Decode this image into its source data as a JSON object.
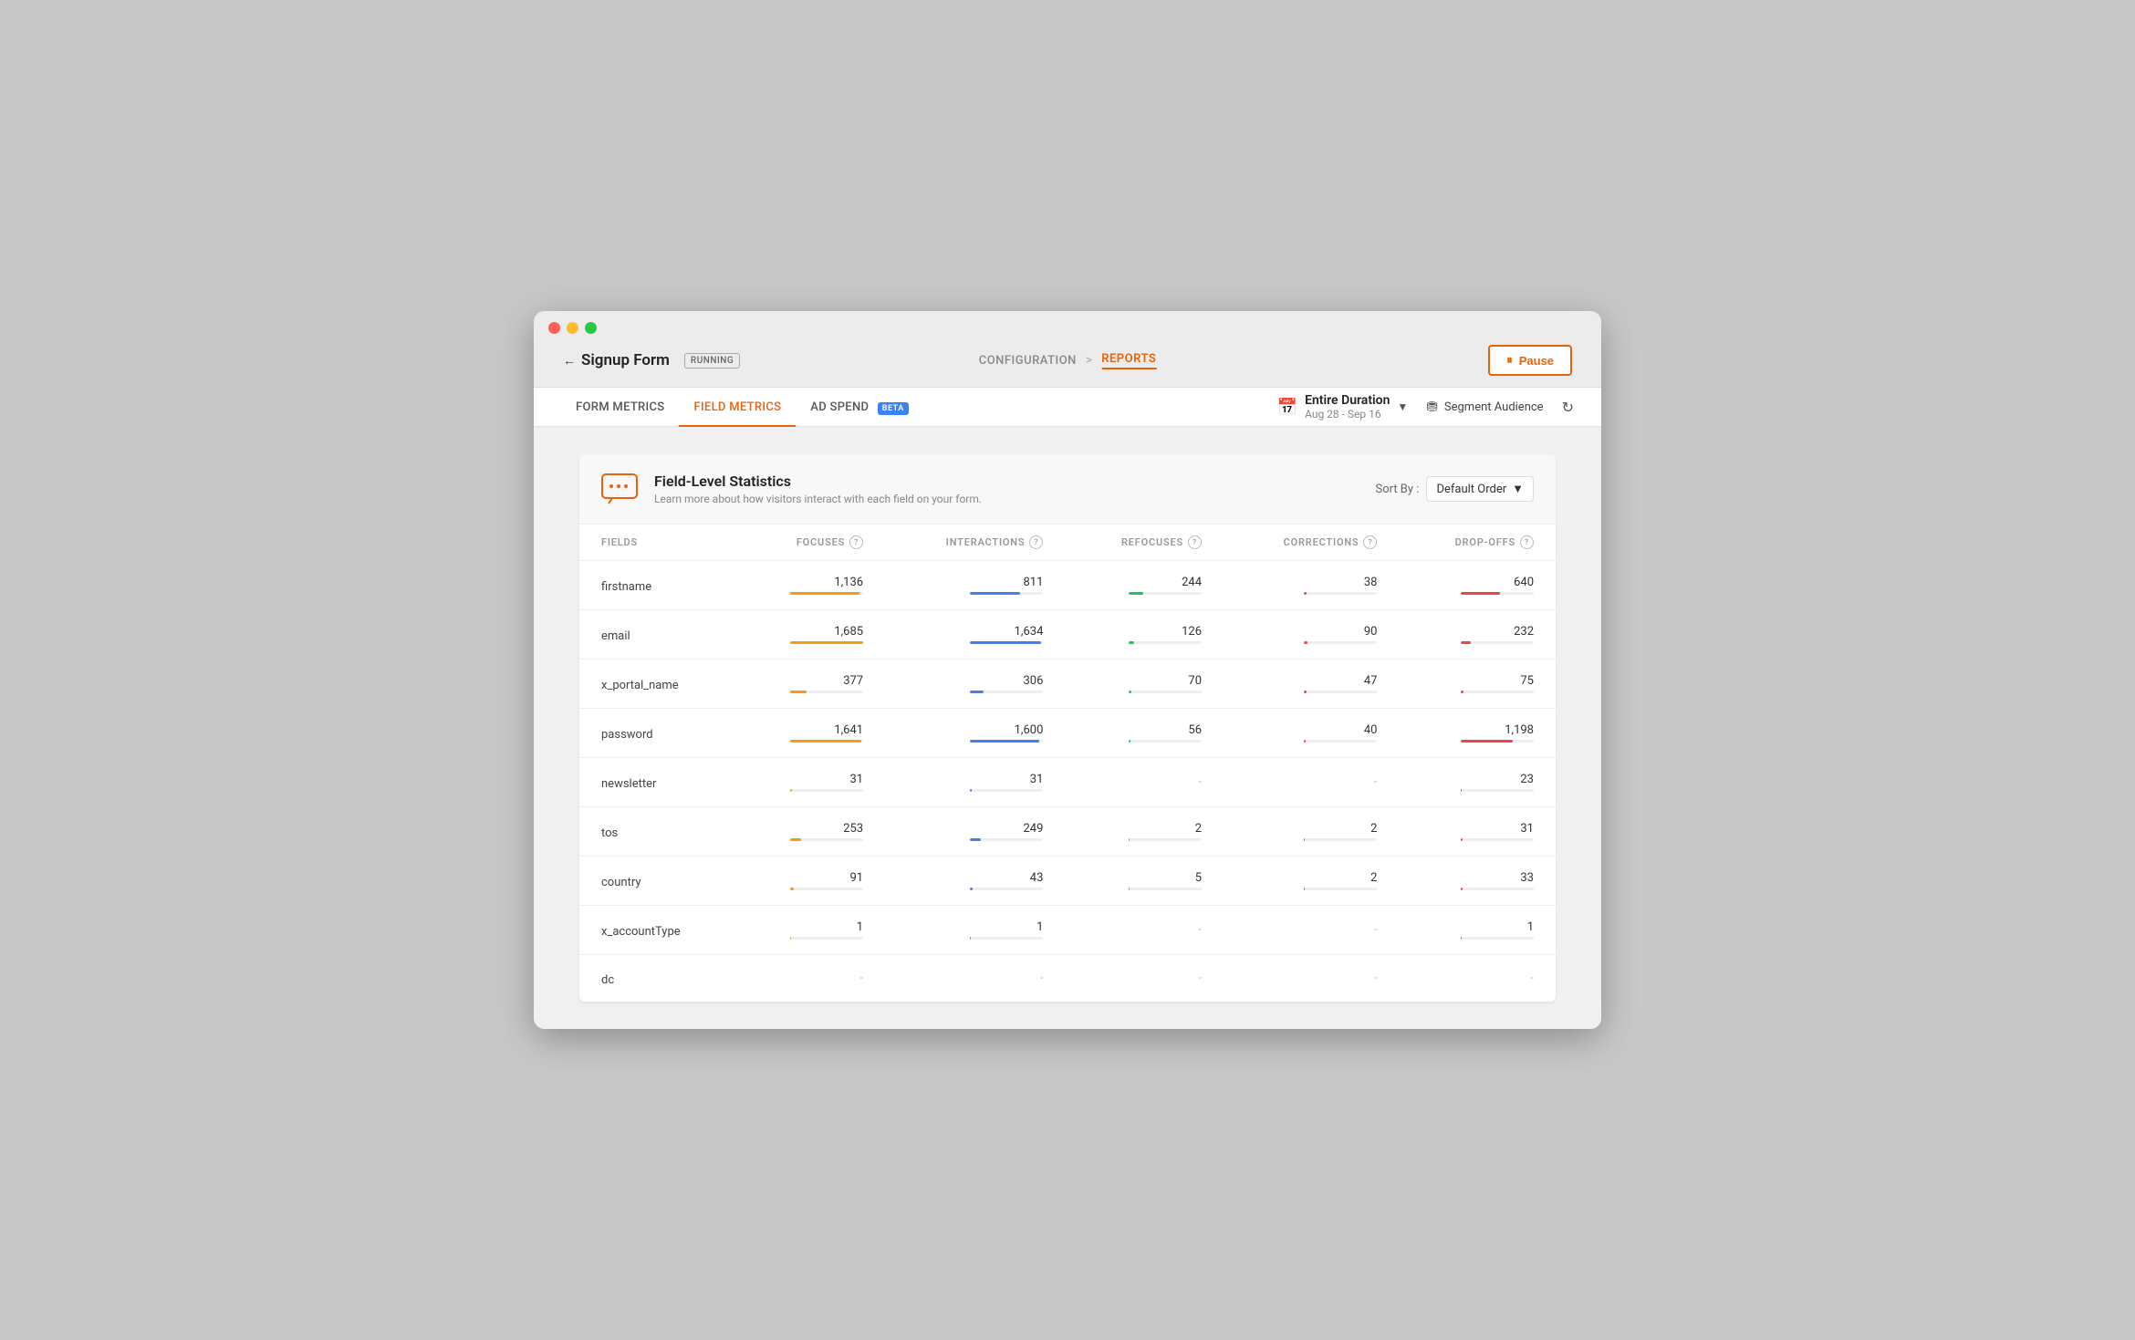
{
  "window": {
    "title": "Signup Form",
    "status": "RUNNING"
  },
  "nav": {
    "back_label": "Signup Form",
    "breadcrumb_config": "CONFIGURATION",
    "breadcrumb_sep": ">",
    "breadcrumb_reports": "REPORTS"
  },
  "pause_button": "Pause",
  "tabs": [
    {
      "id": "form-metrics",
      "label": "FORM METRICS",
      "active": false
    },
    {
      "id": "field-metrics",
      "label": "FIELD METRICS",
      "active": true
    },
    {
      "id": "ad-spend",
      "label": "AD SPEND",
      "active": false,
      "beta": true
    }
  ],
  "toolbar": {
    "date_label": "Entire Duration",
    "date_range": "Aug 28 - Sep 16",
    "segment_label": "Segment Audience"
  },
  "stats": {
    "title": "Field-Level Statistics",
    "subtitle": "Learn more about how visitors interact with each field on your form.",
    "sort_label": "Sort By :",
    "sort_value": "Default Order"
  },
  "table": {
    "headers": [
      {
        "id": "fields",
        "label": "FIELDS"
      },
      {
        "id": "focuses",
        "label": "FOCUSES"
      },
      {
        "id": "interactions",
        "label": "INTERACTIONS"
      },
      {
        "id": "refocuses",
        "label": "REFOCUSES"
      },
      {
        "id": "corrections",
        "label": "CORRECTIONS"
      },
      {
        "id": "dropoffs",
        "label": "DROP-OFFS"
      }
    ],
    "rows": [
      {
        "field": "firstname",
        "focuses": "1,136",
        "focuses_pct": 95,
        "interactions": "811",
        "interactions_pct": 68,
        "interactions_color": "#3b82f6",
        "refocuses": "244",
        "refocuses_pct": 20,
        "refocuses_color": "#22c55e",
        "corrections": "38",
        "corrections_pct": 3,
        "corrections_color": "#ef4444",
        "dropoffs": "640",
        "dropoffs_pct": 54,
        "dropoffs_color": "#ef4444"
      },
      {
        "field": "email",
        "focuses": "1,685",
        "focuses_pct": 100,
        "interactions": "1,634",
        "interactions_pct": 97,
        "interactions_color": "#3b82f6",
        "refocuses": "126",
        "refocuses_pct": 7,
        "refocuses_color": "#22c55e",
        "corrections": "90",
        "corrections_pct": 5,
        "corrections_color": "#ef4444",
        "dropoffs": "232",
        "dropoffs_pct": 14,
        "dropoffs_color": "#ef4444"
      },
      {
        "field": "x_portal_name",
        "focuses": "377",
        "focuses_pct": 22,
        "interactions": "306",
        "interactions_pct": 18,
        "interactions_color": "#3b82f6",
        "refocuses": "70",
        "refocuses_pct": 4,
        "refocuses_color": "#22c55e",
        "corrections": "47",
        "corrections_pct": 3,
        "corrections_color": "#ef4444",
        "dropoffs": "75",
        "dropoffs_pct": 4,
        "dropoffs_color": "#ef4444"
      },
      {
        "field": "password",
        "focuses": "1,641",
        "focuses_pct": 97,
        "interactions": "1,600",
        "interactions_pct": 95,
        "interactions_color": "#3b82f6",
        "refocuses": "56",
        "refocuses_pct": 3,
        "refocuses_color": "#22c55e",
        "corrections": "40",
        "corrections_pct": 2,
        "corrections_color": "#ef4444",
        "dropoffs": "1,198",
        "dropoffs_pct": 71,
        "dropoffs_color": "#ef4444"
      },
      {
        "field": "newsletter",
        "focuses": "31",
        "focuses_pct": 2,
        "interactions": "31",
        "interactions_pct": 2,
        "interactions_color": "#3b82f6",
        "refocuses": null,
        "corrections": null,
        "dropoffs": "23",
        "dropoffs_pct": 1,
        "dropoffs_color": "#ef4444"
      },
      {
        "field": "tos",
        "focuses": "253",
        "focuses_pct": 15,
        "interactions": "249",
        "interactions_pct": 15,
        "interactions_color": "#3b82f6",
        "refocuses": "2",
        "refocuses_pct": 0.1,
        "refocuses_color": "#22c55e",
        "corrections": "2",
        "corrections_pct": 0.1,
        "corrections_color": "#ef4444",
        "dropoffs": "31",
        "dropoffs_pct": 2,
        "dropoffs_color": "#ef4444"
      },
      {
        "field": "country",
        "focuses": "91",
        "focuses_pct": 5,
        "interactions": "43",
        "interactions_pct": 3,
        "interactions_color": "#3b82f6",
        "refocuses": "5",
        "refocuses_pct": 0.3,
        "refocuses_color": "#22c55e",
        "corrections": "2",
        "corrections_pct": 0.1,
        "corrections_color": "#ef4444",
        "dropoffs": "33",
        "dropoffs_pct": 2,
        "dropoffs_color": "#ef4444"
      },
      {
        "field": "x_accountType",
        "focuses": "1",
        "focuses_pct": 0.1,
        "interactions": "1",
        "interactions_pct": 0.1,
        "interactions_color": "#3b82f6",
        "refocuses": null,
        "corrections": null,
        "dropoffs": "1",
        "dropoffs_pct": 0.1,
        "dropoffs_color": "#ef4444"
      },
      {
        "field": "dc",
        "focuses": null,
        "interactions": null,
        "refocuses": null,
        "corrections": null,
        "dropoffs": null
      }
    ]
  }
}
